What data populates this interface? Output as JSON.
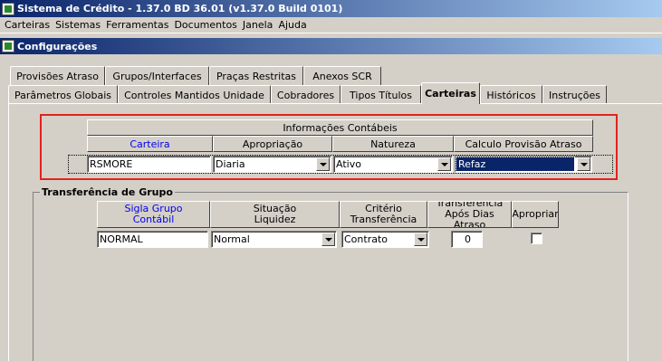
{
  "window": {
    "title": "Sistema de Crédito - 1.37.0 BD 36.01 (v1.37.0 Build 0101)"
  },
  "menu": [
    "Carteiras",
    "Sistemas",
    "Ferramentas",
    "Documentos",
    "Janela",
    "Ajuda"
  ],
  "child_window": {
    "title": "Configurações"
  },
  "tabs_row1": [
    "Provisões Atraso",
    "Grupos/Interfaces",
    "Praças Restritas",
    "Anexos SCR"
  ],
  "tabs_row2": [
    "Parâmetros Globais",
    "Controles Mantidos Unidade",
    "Cobradores",
    "Tipos Títulos",
    "Carteiras",
    "Históricos",
    "Instruções"
  ],
  "active_tab": "Carteiras",
  "info": {
    "group_header": "Informações Contábeis",
    "headers": [
      "Carteira",
      "Apropriação",
      "Natureza",
      "Calculo Provisão Atraso"
    ],
    "row": {
      "carteira": "RSMORE",
      "apropriacao": "Diaria",
      "natureza": "Ativo",
      "calculo": "Refaz"
    }
  },
  "transfer": {
    "label": "Transferência de Grupo",
    "headers": {
      "sigla": "Sigla Grupo\nContábil",
      "situacao": "Situação\nLiquidez",
      "criterio": "Critério\nTransferência",
      "dias": "Transferência\nApós Dias Atraso",
      "apropriar": "Apropriar"
    },
    "row": {
      "sigla": "NORMAL",
      "situacao": "Normal",
      "criterio": "Contrato",
      "dias": "0",
      "apropriar": false
    }
  },
  "colors": {
    "title_bar": "#0a246a",
    "highlight_box": "#e2231a",
    "link_header": "#0000ee"
  }
}
